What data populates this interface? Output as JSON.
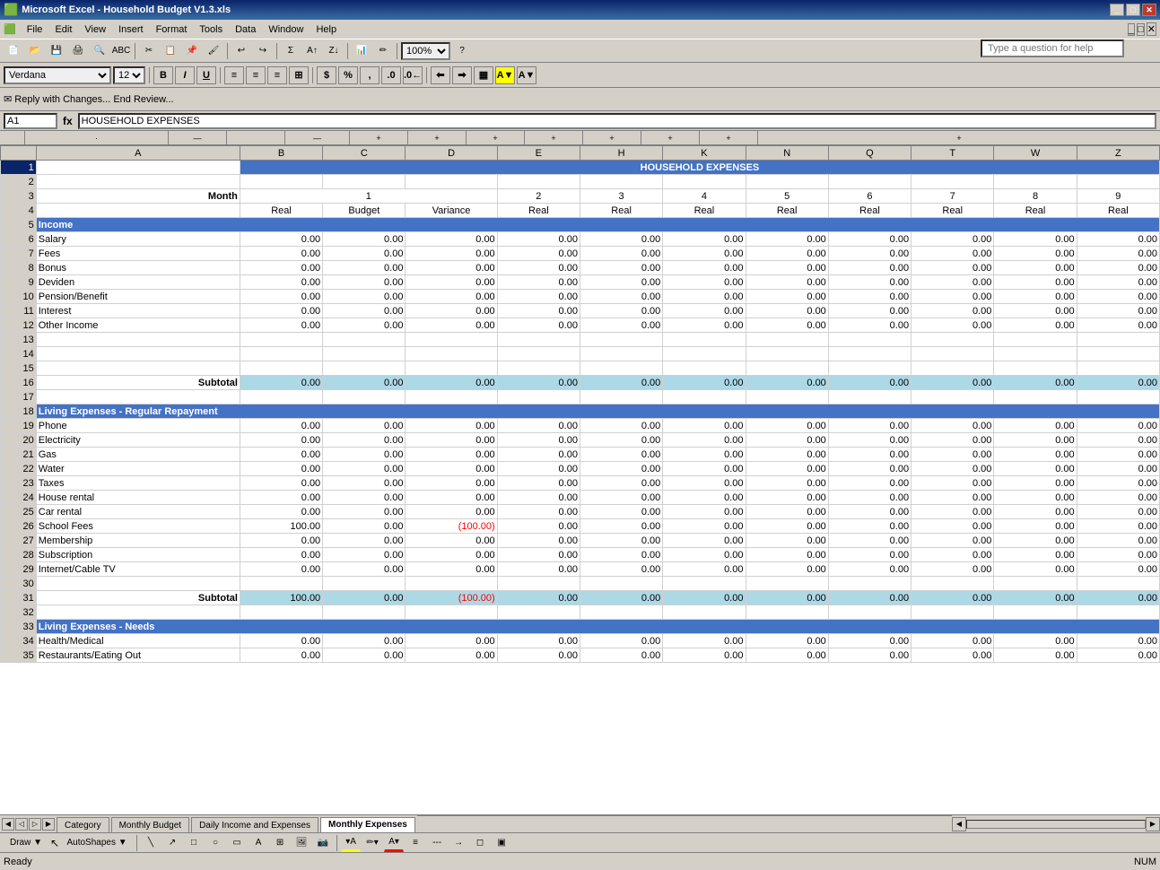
{
  "window": {
    "title": "Microsoft Excel - Household Budget V1.3.xls",
    "icon": "excel-icon"
  },
  "menubar": {
    "items": [
      "File",
      "Edit",
      "View",
      "Insert",
      "Format",
      "Tools",
      "Data",
      "Window",
      "Help"
    ]
  },
  "toolbar1": {
    "buttons": [
      "new",
      "open",
      "save",
      "print",
      "print-preview",
      "spell-check",
      "cut",
      "copy",
      "paste",
      "format-painter",
      "undo",
      "redo",
      "hyperlink",
      "autosum",
      "sort-asc",
      "sort-desc",
      "chart-wizard",
      "draw",
      "zoom"
    ]
  },
  "formatting": {
    "font": "Verdana",
    "size": "12",
    "bold": "B",
    "italic": "I",
    "underline": "U"
  },
  "review_bar": {
    "text": "✉ Reply with Changes...   End Review..."
  },
  "formula_bar": {
    "cell_ref": "A1",
    "fx": "fx",
    "formula": "HOUSEHOLD EXPENSES"
  },
  "spreadsheet": {
    "col_headers": [
      "A",
      "B",
      "C",
      "D",
      "E",
      "H",
      "K",
      "N",
      "Q",
      "T",
      "W",
      "Z"
    ],
    "title_row": "HOUSEHOLD EXPENSES",
    "months_row": [
      "",
      "1",
      "",
      "",
      "2",
      "3",
      "4",
      "5",
      "6",
      "7",
      "8",
      "9"
    ],
    "type_row": [
      "",
      "Real",
      "Budget",
      "Variance",
      "Real",
      "Real",
      "Real",
      "Real",
      "Real",
      "Real",
      "Real",
      "Real"
    ],
    "rows": [
      {
        "num": 1,
        "label": "",
        "type": "title",
        "values": []
      },
      {
        "num": 2,
        "label": "",
        "type": "empty",
        "values": []
      },
      {
        "num": 3,
        "label": "Month",
        "type": "month",
        "values": []
      },
      {
        "num": 4,
        "label": "",
        "type": "header",
        "values": [
          "Real",
          "Budget",
          "Variance",
          "Real",
          "Real",
          "Real",
          "Real",
          "Real",
          "Real",
          "Real",
          "Real"
        ]
      },
      {
        "num": 5,
        "label": "Income",
        "type": "section",
        "values": []
      },
      {
        "num": 6,
        "label": "Salary",
        "type": "data",
        "values": [
          "0.00",
          "0.00",
          "0.00",
          "0.00",
          "0.00",
          "0.00",
          "0.00",
          "0.00",
          "0.00",
          "0.00",
          "0.00"
        ]
      },
      {
        "num": 7,
        "label": "Fees",
        "type": "data",
        "values": [
          "0.00",
          "0.00",
          "0.00",
          "0.00",
          "0.00",
          "0.00",
          "0.00",
          "0.00",
          "0.00",
          "0.00",
          "0.00"
        ]
      },
      {
        "num": 8,
        "label": "Bonus",
        "type": "data",
        "values": [
          "0.00",
          "0.00",
          "0.00",
          "0.00",
          "0.00",
          "0.00",
          "0.00",
          "0.00",
          "0.00",
          "0.00",
          "0.00"
        ]
      },
      {
        "num": 9,
        "label": "Deviden",
        "type": "data",
        "values": [
          "0.00",
          "0.00",
          "0.00",
          "0.00",
          "0.00",
          "0.00",
          "0.00",
          "0.00",
          "0.00",
          "0.00",
          "0.00"
        ]
      },
      {
        "num": 10,
        "label": "Pension/Benefit",
        "type": "data",
        "values": [
          "0.00",
          "0.00",
          "0.00",
          "0.00",
          "0.00",
          "0.00",
          "0.00",
          "0.00",
          "0.00",
          "0.00",
          "0.00"
        ]
      },
      {
        "num": 11,
        "label": "Interest",
        "type": "data",
        "values": [
          "0.00",
          "0.00",
          "0.00",
          "0.00",
          "0.00",
          "0.00",
          "0.00",
          "0.00",
          "0.00",
          "0.00",
          "0.00"
        ]
      },
      {
        "num": 12,
        "label": "Other Income",
        "type": "data",
        "values": [
          "0.00",
          "0.00",
          "0.00",
          "0.00",
          "0.00",
          "0.00",
          "0.00",
          "0.00",
          "0.00",
          "0.00",
          "0.00"
        ]
      },
      {
        "num": 13,
        "label": "",
        "type": "empty",
        "values": []
      },
      {
        "num": 14,
        "label": "",
        "type": "empty",
        "values": []
      },
      {
        "num": 15,
        "label": "",
        "type": "empty",
        "values": []
      },
      {
        "num": 16,
        "label": "Subtotal",
        "type": "subtotal",
        "values": [
          "0.00",
          "0.00",
          "0.00",
          "0.00",
          "0.00",
          "0.00",
          "0.00",
          "0.00",
          "0.00",
          "0.00",
          "0.00"
        ]
      },
      {
        "num": 17,
        "label": "",
        "type": "empty",
        "values": []
      },
      {
        "num": 18,
        "label": "Living Expenses - Regular Repayment",
        "type": "section",
        "values": []
      },
      {
        "num": 19,
        "label": "Phone",
        "type": "data",
        "values": [
          "0.00",
          "0.00",
          "0.00",
          "0.00",
          "0.00",
          "0.00",
          "0.00",
          "0.00",
          "0.00",
          "0.00",
          "0.00"
        ]
      },
      {
        "num": 20,
        "label": "Electricity",
        "type": "data",
        "values": [
          "0.00",
          "0.00",
          "0.00",
          "0.00",
          "0.00",
          "0.00",
          "0.00",
          "0.00",
          "0.00",
          "0.00",
          "0.00"
        ]
      },
      {
        "num": 21,
        "label": "Gas",
        "type": "data",
        "values": [
          "0.00",
          "0.00",
          "0.00",
          "0.00",
          "0.00",
          "0.00",
          "0.00",
          "0.00",
          "0.00",
          "0.00",
          "0.00"
        ]
      },
      {
        "num": 22,
        "label": "Water",
        "type": "data",
        "values": [
          "0.00",
          "0.00",
          "0.00",
          "0.00",
          "0.00",
          "0.00",
          "0.00",
          "0.00",
          "0.00",
          "0.00",
          "0.00"
        ]
      },
      {
        "num": 23,
        "label": "Taxes",
        "type": "data",
        "values": [
          "0.00",
          "0.00",
          "0.00",
          "0.00",
          "0.00",
          "0.00",
          "0.00",
          "0.00",
          "0.00",
          "0.00",
          "0.00"
        ]
      },
      {
        "num": 24,
        "label": "House rental",
        "type": "data",
        "values": [
          "0.00",
          "0.00",
          "0.00",
          "0.00",
          "0.00",
          "0.00",
          "0.00",
          "0.00",
          "0.00",
          "0.00",
          "0.00"
        ]
      },
      {
        "num": 25,
        "label": "Car rental",
        "type": "data",
        "values": [
          "0.00",
          "0.00",
          "0.00",
          "0.00",
          "0.00",
          "0.00",
          "0.00",
          "0.00",
          "0.00",
          "0.00",
          "0.00"
        ]
      },
      {
        "num": 26,
        "label": "School Fees",
        "type": "data",
        "values": [
          "100.00",
          "0.00",
          "(100.00)",
          "0.00",
          "0.00",
          "0.00",
          "0.00",
          "0.00",
          "0.00",
          "0.00",
          "0.00"
        ],
        "variance_neg": true
      },
      {
        "num": 27,
        "label": "Membership",
        "type": "data",
        "values": [
          "0.00",
          "0.00",
          "0.00",
          "0.00",
          "0.00",
          "0.00",
          "0.00",
          "0.00",
          "0.00",
          "0.00",
          "0.00"
        ]
      },
      {
        "num": 28,
        "label": "Subscription",
        "type": "data",
        "values": [
          "0.00",
          "0.00",
          "0.00",
          "0.00",
          "0.00",
          "0.00",
          "0.00",
          "0.00",
          "0.00",
          "0.00",
          "0.00"
        ]
      },
      {
        "num": 29,
        "label": "Internet/Cable TV",
        "type": "data",
        "values": [
          "0.00",
          "0.00",
          "0.00",
          "0.00",
          "0.00",
          "0.00",
          "0.00",
          "0.00",
          "0.00",
          "0.00",
          "0.00"
        ]
      },
      {
        "num": 30,
        "label": "",
        "type": "empty",
        "values": []
      },
      {
        "num": 31,
        "label": "Subtotal",
        "type": "subtotal",
        "values": [
          "100.00",
          "0.00",
          "(100.00)",
          "0.00",
          "0.00",
          "0.00",
          "0.00",
          "0.00",
          "0.00",
          "0.00",
          "0.00"
        ],
        "variance_neg": true
      },
      {
        "num": 32,
        "label": "",
        "type": "empty",
        "values": []
      },
      {
        "num": 33,
        "label": "Living Expenses - Needs",
        "type": "section",
        "values": []
      },
      {
        "num": 34,
        "label": "Health/Medical",
        "type": "data",
        "values": [
          "0.00",
          "0.00",
          "0.00",
          "0.00",
          "0.00",
          "0.00",
          "0.00",
          "0.00",
          "0.00",
          "0.00",
          "0.00"
        ]
      },
      {
        "num": 35,
        "label": "Restaurants/Eating Out",
        "type": "data",
        "values": [
          "0.00",
          "0.00",
          "0.00",
          "0.00",
          "0.00",
          "0.00",
          "0.00",
          "0.00",
          "0.00",
          "0.00",
          "0.00"
        ]
      }
    ]
  },
  "sheet_tabs": {
    "tabs": [
      "Category",
      "Monthly Budget",
      "Daily Income and Expenses",
      "Monthly Expenses"
    ],
    "active": "Monthly Expenses"
  },
  "status_bar": {
    "left": "Ready",
    "right": "NUM"
  },
  "draw_toolbar": {
    "draw_label": "Draw ▼",
    "autoshapes": "AutoShapes ▼"
  },
  "help_placeholder": "Type a question for help"
}
